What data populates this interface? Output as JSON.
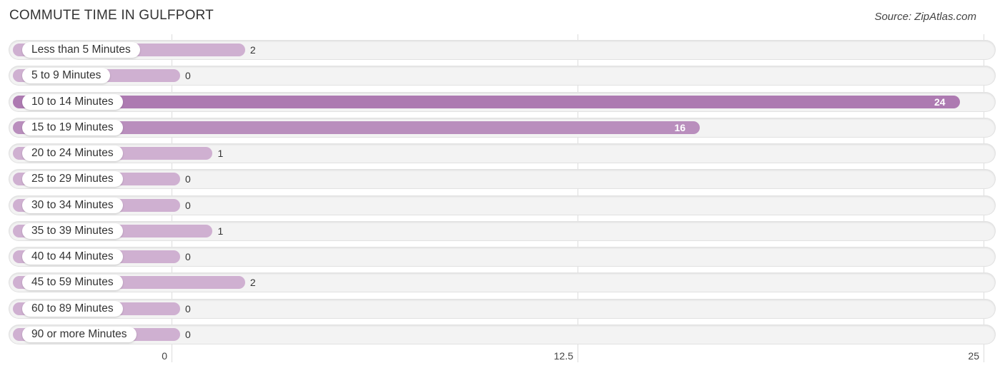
{
  "header": {
    "title": "COMMUTE TIME IN GULFPORT",
    "source": "Source: ZipAtlas.com"
  },
  "colors": {
    "bar_light": "#cfb0d1",
    "bar_strong": "#ad7ab1",
    "bar_mid": "#b98ebd",
    "track": "#f3f3f3"
  },
  "chart_data": {
    "type": "bar",
    "orientation": "horizontal",
    "title": "COMMUTE TIME IN GULFPORT",
    "xlabel": "",
    "ylabel": "",
    "xlim": [
      0,
      25
    ],
    "x_ticks": [
      "0",
      "12.5",
      "25"
    ],
    "grid": true,
    "categories": [
      "Less than 5 Minutes",
      "5 to 9 Minutes",
      "10 to 14 Minutes",
      "15 to 19 Minutes",
      "20 to 24 Minutes",
      "25 to 29 Minutes",
      "30 to 34 Minutes",
      "35 to 39 Minutes",
      "40 to 44 Minutes",
      "45 to 59 Minutes",
      "60 to 89 Minutes",
      "90 or more Minutes"
    ],
    "values": [
      2,
      0,
      24,
      16,
      1,
      0,
      0,
      1,
      0,
      2,
      0,
      0
    ]
  }
}
